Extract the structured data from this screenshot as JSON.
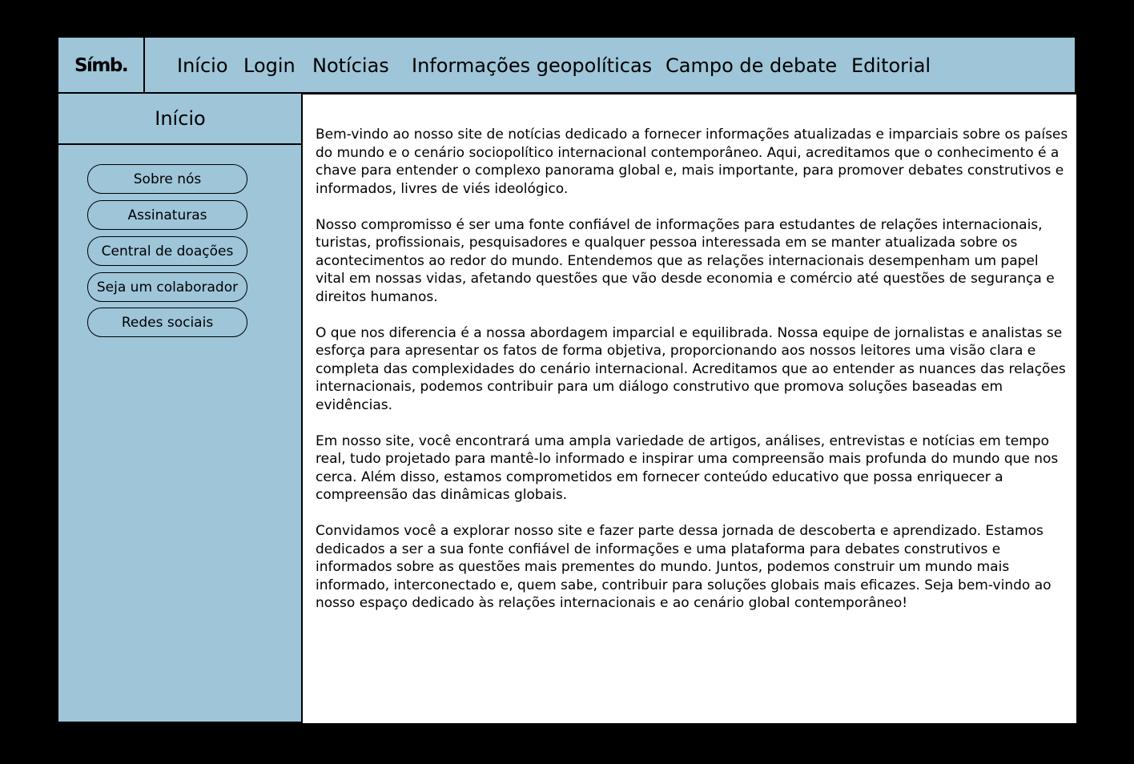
{
  "header": {
    "logo": "Símb.",
    "nav": [
      "Início",
      "Login",
      "Notícias",
      "Informações geopolíticas",
      "Campo de debate",
      "Editorial"
    ]
  },
  "sidebar": {
    "title": "Início",
    "items": [
      "Sobre nós",
      "Assinaturas",
      "Central de doações",
      "Seja um colaborador",
      "Redes sociais"
    ]
  },
  "content": {
    "paragraphs": [
      "Bem-vindo ao nosso site de notícias dedicado a fornecer informações atualizadas e imparciais sobre os países do mundo e o cenário sociopolítico internacional contemporâneo. Aqui, acreditamos que o conhecimento é a chave para entender o complexo panorama global e, mais importante, para promover debates construtivos e informados, livres de viés ideológico.",
      "Nosso compromisso é ser uma fonte confiável de informações para estudantes de relações internacionais, turistas, profissionais, pesquisadores e qualquer pessoa interessada em se manter atualizada sobre os acontecimentos ao redor do mundo. Entendemos que as relações internacionais desempenham um papel vital em nossas vidas, afetando questões que vão desde economia e comércio até questões de segurança e direitos humanos.",
      "O que nos diferencia é a nossa abordagem imparcial e equilibrada. Nossa equipe de jornalistas e analistas se esforça para apresentar os fatos de forma objetiva, proporcionando aos nossos leitores uma visão clara e completa das complexidades do cenário internacional. Acreditamos que ao entender as nuances das relações internacionais, podemos contribuir para um diálogo construtivo que promova soluções baseadas em evidências.",
      "Em nosso site, você encontrará uma ampla variedade de artigos, análises, entrevistas e notícias em tempo real, tudo projetado para mantê-lo informado e inspirar uma compreensão mais profunda do mundo que nos cerca. Além disso, estamos comprometidos em fornecer conteúdo educativo que possa enriquecer a compreensão das dinâmicas globais.",
      "Convidamos você a explorar nosso site e fazer parte dessa jornada de descoberta e aprendizado. Estamos dedicados a ser a sua fonte confiável de informações e uma plataforma para debates construtivos e informados sobre as questões mais prementes do mundo. Juntos, podemos construir um mundo mais informado, interconectado e, quem sabe, contribuir para soluções globais mais eficazes. Seja bem-vindo ao nosso espaço dedicado às relações internacionais e ao cenário global contemporâneo!"
    ]
  },
  "colors": {
    "background": "#000000",
    "panel": "#9ec5d8",
    "content": "#ffffff"
  }
}
